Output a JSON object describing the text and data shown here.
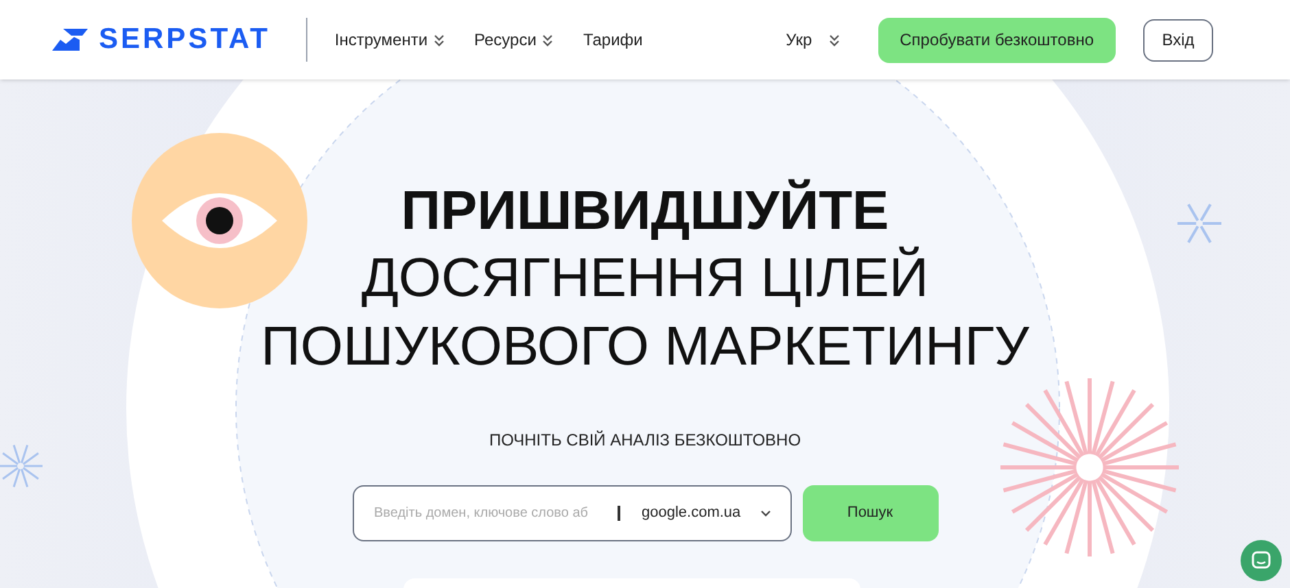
{
  "header": {
    "logo": "SERPSTAT",
    "nav": [
      {
        "label": "Інструменти",
        "dropdown": true
      },
      {
        "label": "Ресурси",
        "dropdown": true
      },
      {
        "label": "Тарифи",
        "dropdown": false
      }
    ],
    "language": "Укр",
    "cta": "Спробувати безкоштовно",
    "login": "Вхід"
  },
  "hero": {
    "title_bold": "ПРИШВИДШУЙТЕ",
    "title_lines": [
      "ДОСЯГНЕННЯ ЦІЛЕЙ",
      "ПОШУКОВОГО МАРКЕТИНГУ"
    ],
    "subtitle": "ПОЧНІТЬ СВІЙ АНАЛІЗ БЕЗКОШТОВНО"
  },
  "search": {
    "placeholder": "Введіть домен, ключове слово аб",
    "engine": "google.com.ua",
    "button": "Пошук"
  }
}
